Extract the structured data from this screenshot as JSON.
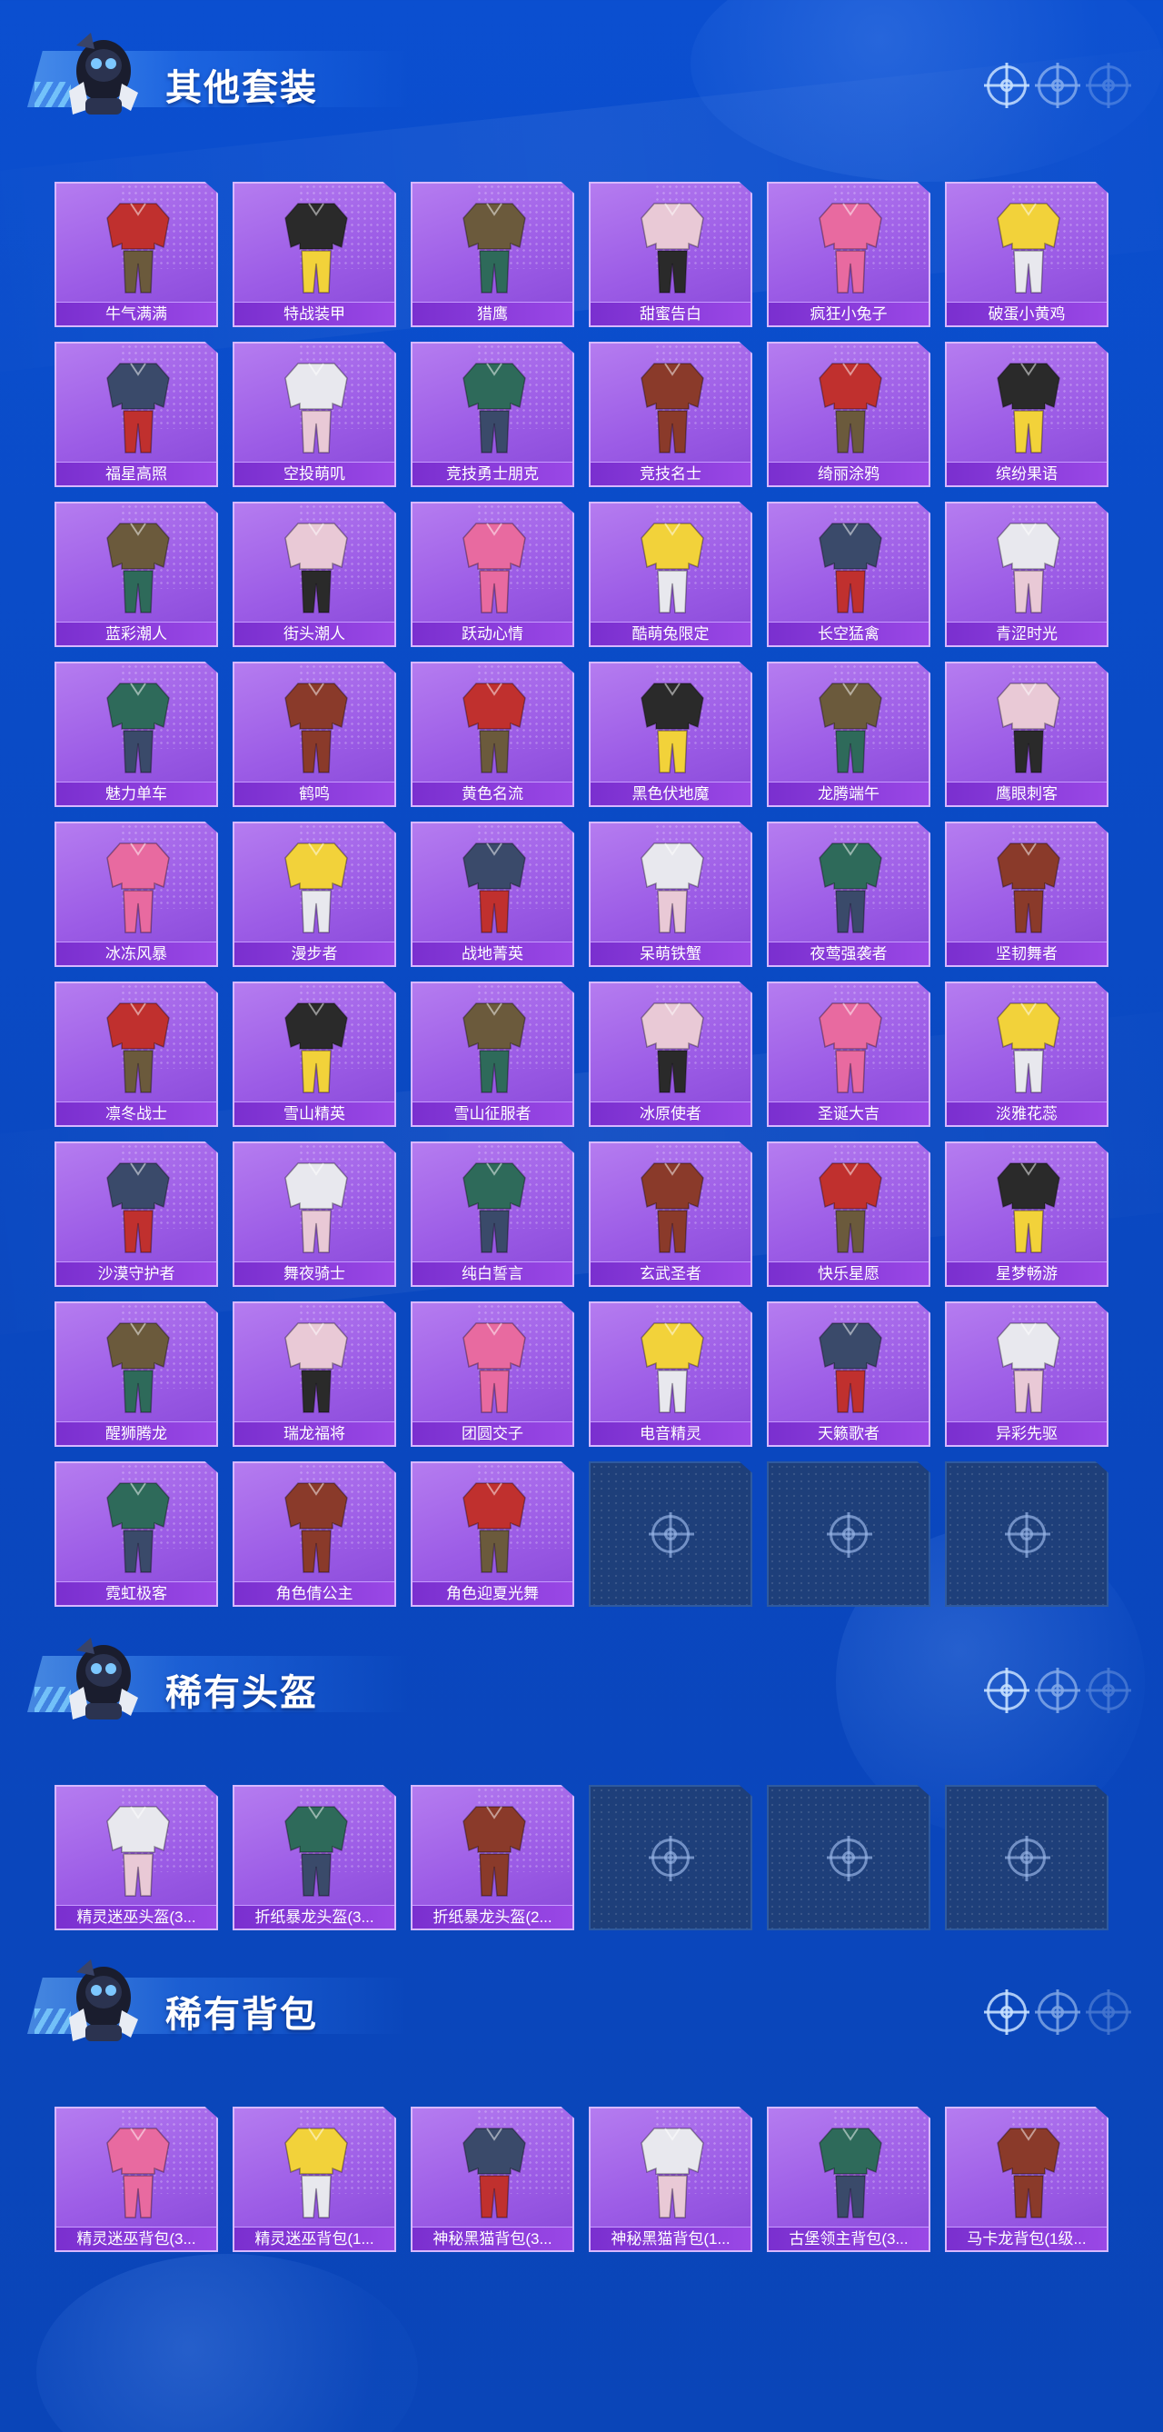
{
  "sections": [
    {
      "title": "其他套装",
      "items": [
        "牛气满满",
        "特战装甲",
        "猎鹰",
        "甜蜜告白",
        "疯狂小兔子",
        "破蛋小黄鸡",
        "福星高照",
        "空投萌叽",
        "竞技勇士朋克",
        "竞技名士",
        "绮丽涂鸦",
        "缤纷果语",
        "蓝彩潮人",
        "街头潮人",
        "跃动心情",
        "酷萌兔限定",
        "长空猛禽",
        "青涩时光",
        "魅力单车",
        "鹤鸣",
        "黄色名流",
        "黑色伏地魔",
        "龙腾端午",
        "鹰眼刺客",
        "冰冻风暴",
        "漫步者",
        "战地菁英",
        "呆萌铁蟹",
        "夜莺强袭者",
        "坚韧舞者",
        "凛冬战士",
        "雪山精英",
        "雪山征服者",
        "冰原使者",
        "圣诞大吉",
        "淡雅花蕊",
        "沙漠守护者",
        "舞夜骑士",
        "纯白誓言",
        "玄武圣者",
        "快乐星愿",
        "星梦畅游",
        "醒狮腾龙",
        "瑞龙福将",
        "团圆交子",
        "电音精灵",
        "天籁歌者",
        "异彩先驱",
        "霓虹极客",
        "角色倩公主",
        "角色迎夏光舞"
      ]
    },
    {
      "title": "稀有头盔",
      "items": [
        "精灵迷巫头盔(3...",
        "折纸暴龙头盔(3...",
        "折纸暴龙头盔(2..."
      ]
    },
    {
      "title": "稀有背包",
      "items": [
        "精灵迷巫背包(3...",
        "精灵迷巫背包(1...",
        "神秘黑猫背包(3...",
        "神秘黑猫背包(1...",
        "古堡领主背包(3...",
        "马卡龙背包(1级..."
      ]
    }
  ],
  "colors": {
    "background": "#0b4fd0",
    "card_purple": "#9c5ce6",
    "label_bar": "#7a2fcf",
    "empty_slot": "#1e3f7a"
  },
  "icons": [
    "crosshair-icon",
    "mascot-icon",
    "outfit-icon"
  ]
}
